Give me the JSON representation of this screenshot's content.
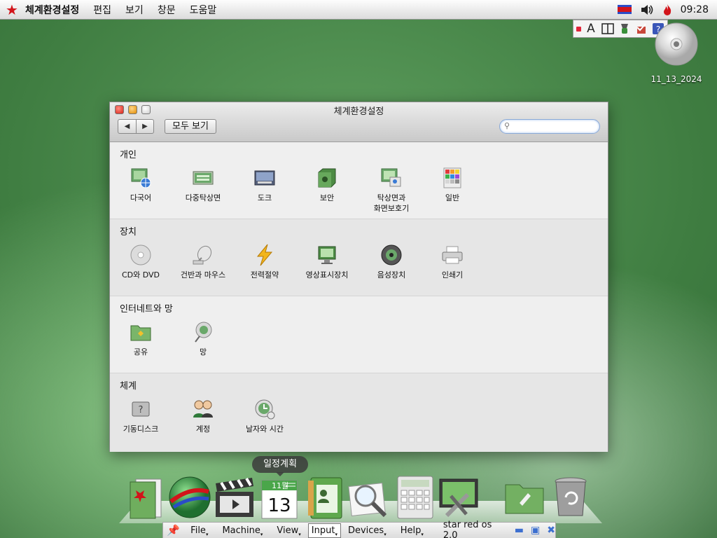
{
  "menubar": {
    "app_name": "체계환경설정",
    "items": [
      "편집",
      "보기",
      "창문",
      "도움말"
    ],
    "clock": "09:28"
  },
  "ime_panel": {
    "letter": "A"
  },
  "desktop": {
    "cd_label": "11_13_2024"
  },
  "window": {
    "title": "체계환경설정",
    "show_all": "모두 보기",
    "search_placeholder": "",
    "sections": [
      {
        "title": "개인",
        "items": [
          {
            "label": "다국어",
            "icon": "multilingual-icon"
          },
          {
            "label": "다중탁상면",
            "icon": "multi-desktop-icon"
          },
          {
            "label": "도크",
            "icon": "dock-icon"
          },
          {
            "label": "보안",
            "icon": "security-icon"
          },
          {
            "label": "탁상면과",
            "label2": "화면보호기",
            "icon": "screensaver-icon"
          },
          {
            "label": "일반",
            "icon": "general-icon"
          }
        ]
      },
      {
        "title": "장치",
        "items": [
          {
            "label": "CD와 DVD",
            "icon": "cd-dvd-icon"
          },
          {
            "label": "건반과 마우스",
            "icon": "keyboard-mouse-icon"
          },
          {
            "label": "전력절약",
            "icon": "power-icon"
          },
          {
            "label": "영상표시장치",
            "icon": "display-icon"
          },
          {
            "label": "음성장치",
            "icon": "sound-icon"
          },
          {
            "label": "인쇄기",
            "icon": "printer-icon"
          }
        ]
      },
      {
        "title": "인터네트와 망",
        "items": [
          {
            "label": "공유",
            "icon": "sharing-icon"
          },
          {
            "label": "망",
            "icon": "network-icon"
          }
        ]
      },
      {
        "title": "체계",
        "items": [
          {
            "label": "기동디스크",
            "icon": "startup-disk-icon"
          },
          {
            "label": "계정",
            "icon": "accounts-icon"
          },
          {
            "label": "날자와 시간",
            "icon": "date-time-icon"
          }
        ]
      }
    ]
  },
  "dock": {
    "tooltip": "일정계획",
    "calendar_month": "11월",
    "calendar_day": "13",
    "items": [
      "documents-icon",
      "browser-globe-icon",
      "video-clapper-icon",
      "calendar-icon",
      "address-book-icon",
      "search-magnifier-icon",
      "calculator-icon",
      "system-tools-icon",
      "folder-icon",
      "trash-icon"
    ]
  },
  "vm_bar": {
    "menus": [
      "File",
      "Machine",
      "View",
      "Input",
      "Devices",
      "Help"
    ],
    "label": "star red os 2.0"
  },
  "colors": {
    "accent_red": "#d2141a",
    "desktop_green": "#3f7d41",
    "window_bg": "#efefef"
  }
}
